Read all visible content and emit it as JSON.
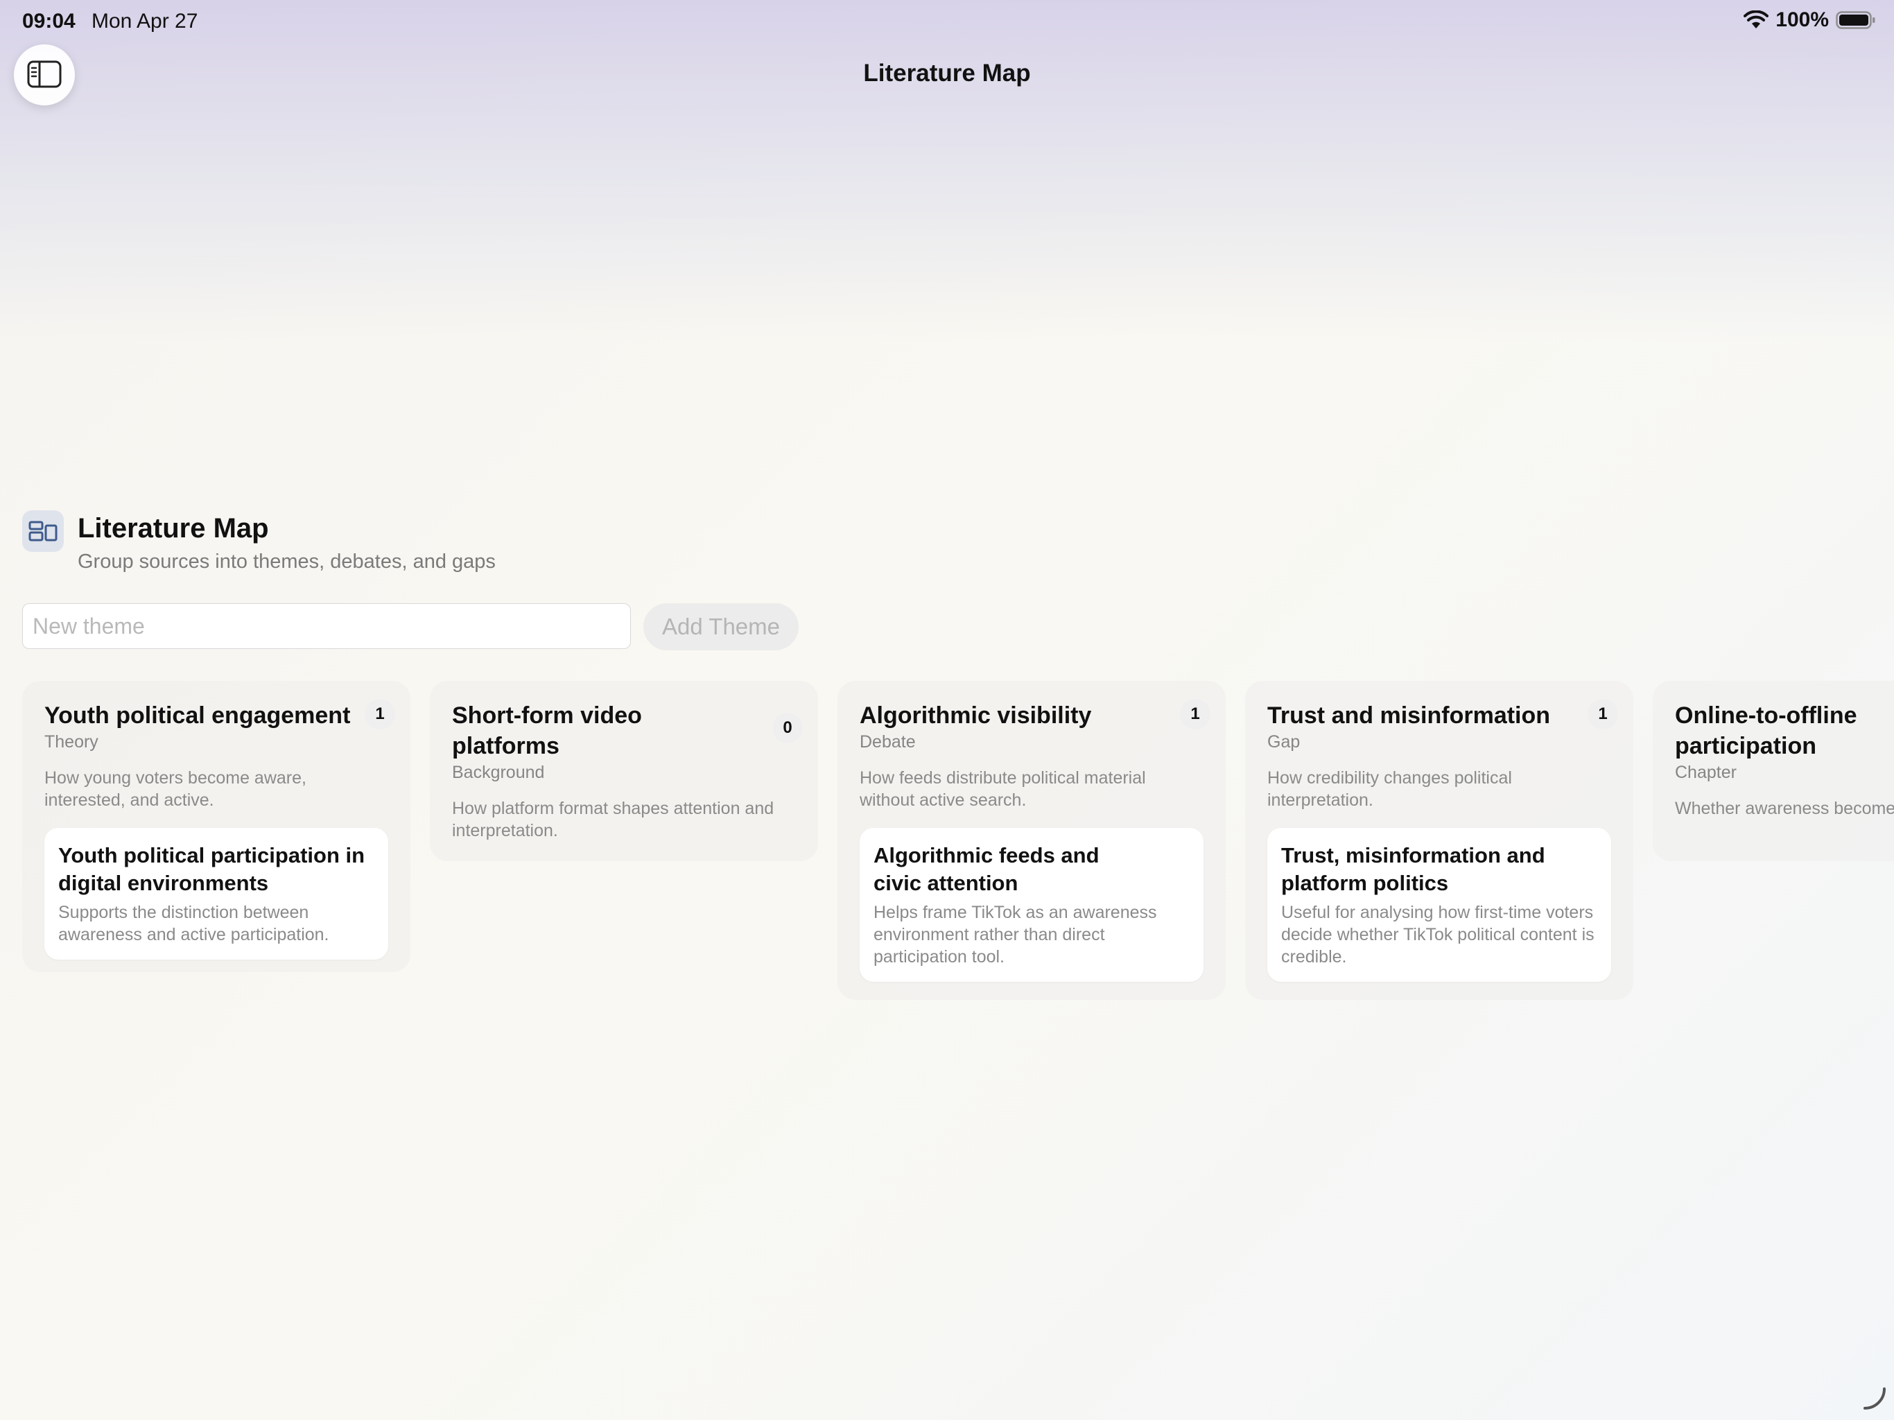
{
  "status_bar": {
    "time": "09:04",
    "date": "Mon Apr 27",
    "battery": "100%"
  },
  "nav": {
    "title": "Literature Map"
  },
  "header": {
    "title": "Literature Map",
    "subtitle": "Group sources into themes, debates, and gaps"
  },
  "theme_input": {
    "placeholder": "New theme",
    "value": "",
    "add_label": "Add Theme"
  },
  "themes": [
    {
      "title": "Youth political engagement",
      "type": "Theme"
    },
    {
      "title": "Short-form video platforms",
      "type": "Background"
    },
    {
      "title": "Algorithmic visibility",
      "type": "Debate"
    },
    {
      "title": "Trust and misinformation",
      "type": "Gap"
    },
    {
      "title": "Online-to-offline participation",
      "type": "Chapter"
    }
  ],
  "columns": [
    {
      "title": "Youth political engagement",
      "type": "Theory",
      "count": "1",
      "description": "How young voters become aware, interested, and active.",
      "source": {
        "title": "Youth political participation in digital environments",
        "note": "Supports the distinction between awareness and active participation."
      }
    },
    {
      "title": "Short-form video platforms",
      "type": "Background",
      "count": "0",
      "description": "How platform format shapes attention and interpretation."
    },
    {
      "title": "Algorithmic visibility",
      "type": "Debate",
      "count": "1",
      "description": "How feeds distribute political material without active search.",
      "source": {
        "title": "Algorithmic feeds and civic attention",
        "note": "Helps frame TikTok as an awareness environment rather than direct participation tool."
      }
    },
    {
      "title": "Trust and misinformation",
      "type": "Gap",
      "count": "1",
      "description": "How credibility changes political interpretation.",
      "source": {
        "title": "Trust, misinformation and platform politics",
        "note": "Useful for analysing how first-time voters decide whether TikTok political content is credible."
      }
    },
    {
      "title": "Online-to-offline participation",
      "type": "Chapter",
      "description": "Whether awareness become"
    }
  ]
}
